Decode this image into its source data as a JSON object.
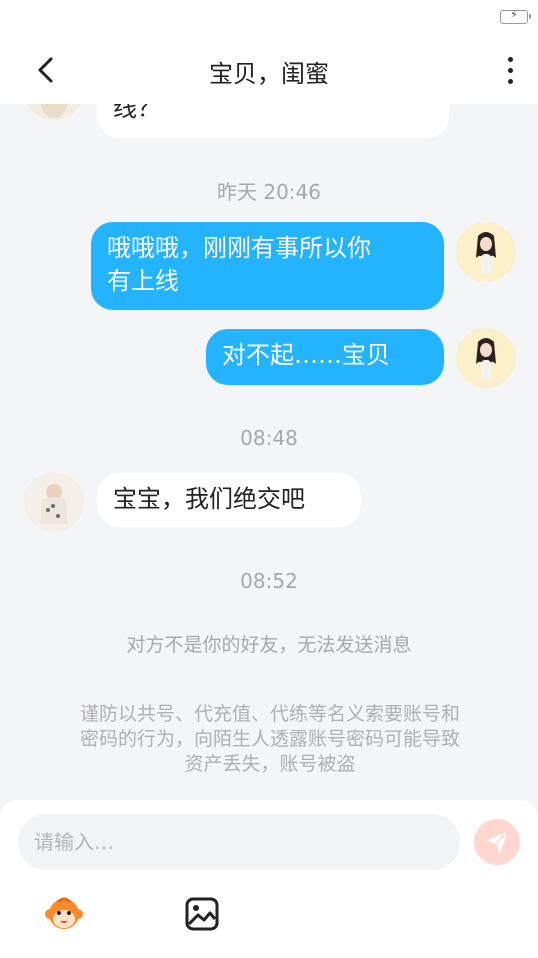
{
  "header": {
    "title": "宝贝，闺蜜"
  },
  "messages": {
    "partial_in": "线？",
    "time_1": "昨天 20:46",
    "out_1_line1": "哦哦哦，刚刚有事所以你",
    "out_1_line2": "有上线",
    "out_2": "对不起……宝贝",
    "time_2": "08:48",
    "in_1": "宝宝，我们绝交吧",
    "time_3": "08:52"
  },
  "notice": "对方不是你的好友，无法发送消息",
  "warning": {
    "line1": "谨防以共号、代充值、代练等名义索要账号和",
    "line2": "密码的行为，向陌生人透露账号密码可能导致",
    "line3": "资产丢失，账号被盗"
  },
  "composer": {
    "placeholder": "请输入…"
  },
  "icons": {
    "back": "chevron-left-icon",
    "more": "more-vertical-icon",
    "send": "send-plane-icon",
    "emoji": "monkey-emoji-icon",
    "image": "image-icon",
    "battery": "battery-charging-icon"
  },
  "colors": {
    "outgoing_bubble": "#24b3ff",
    "send_button": "#ffd6d0",
    "background": "#f4f5f7"
  }
}
